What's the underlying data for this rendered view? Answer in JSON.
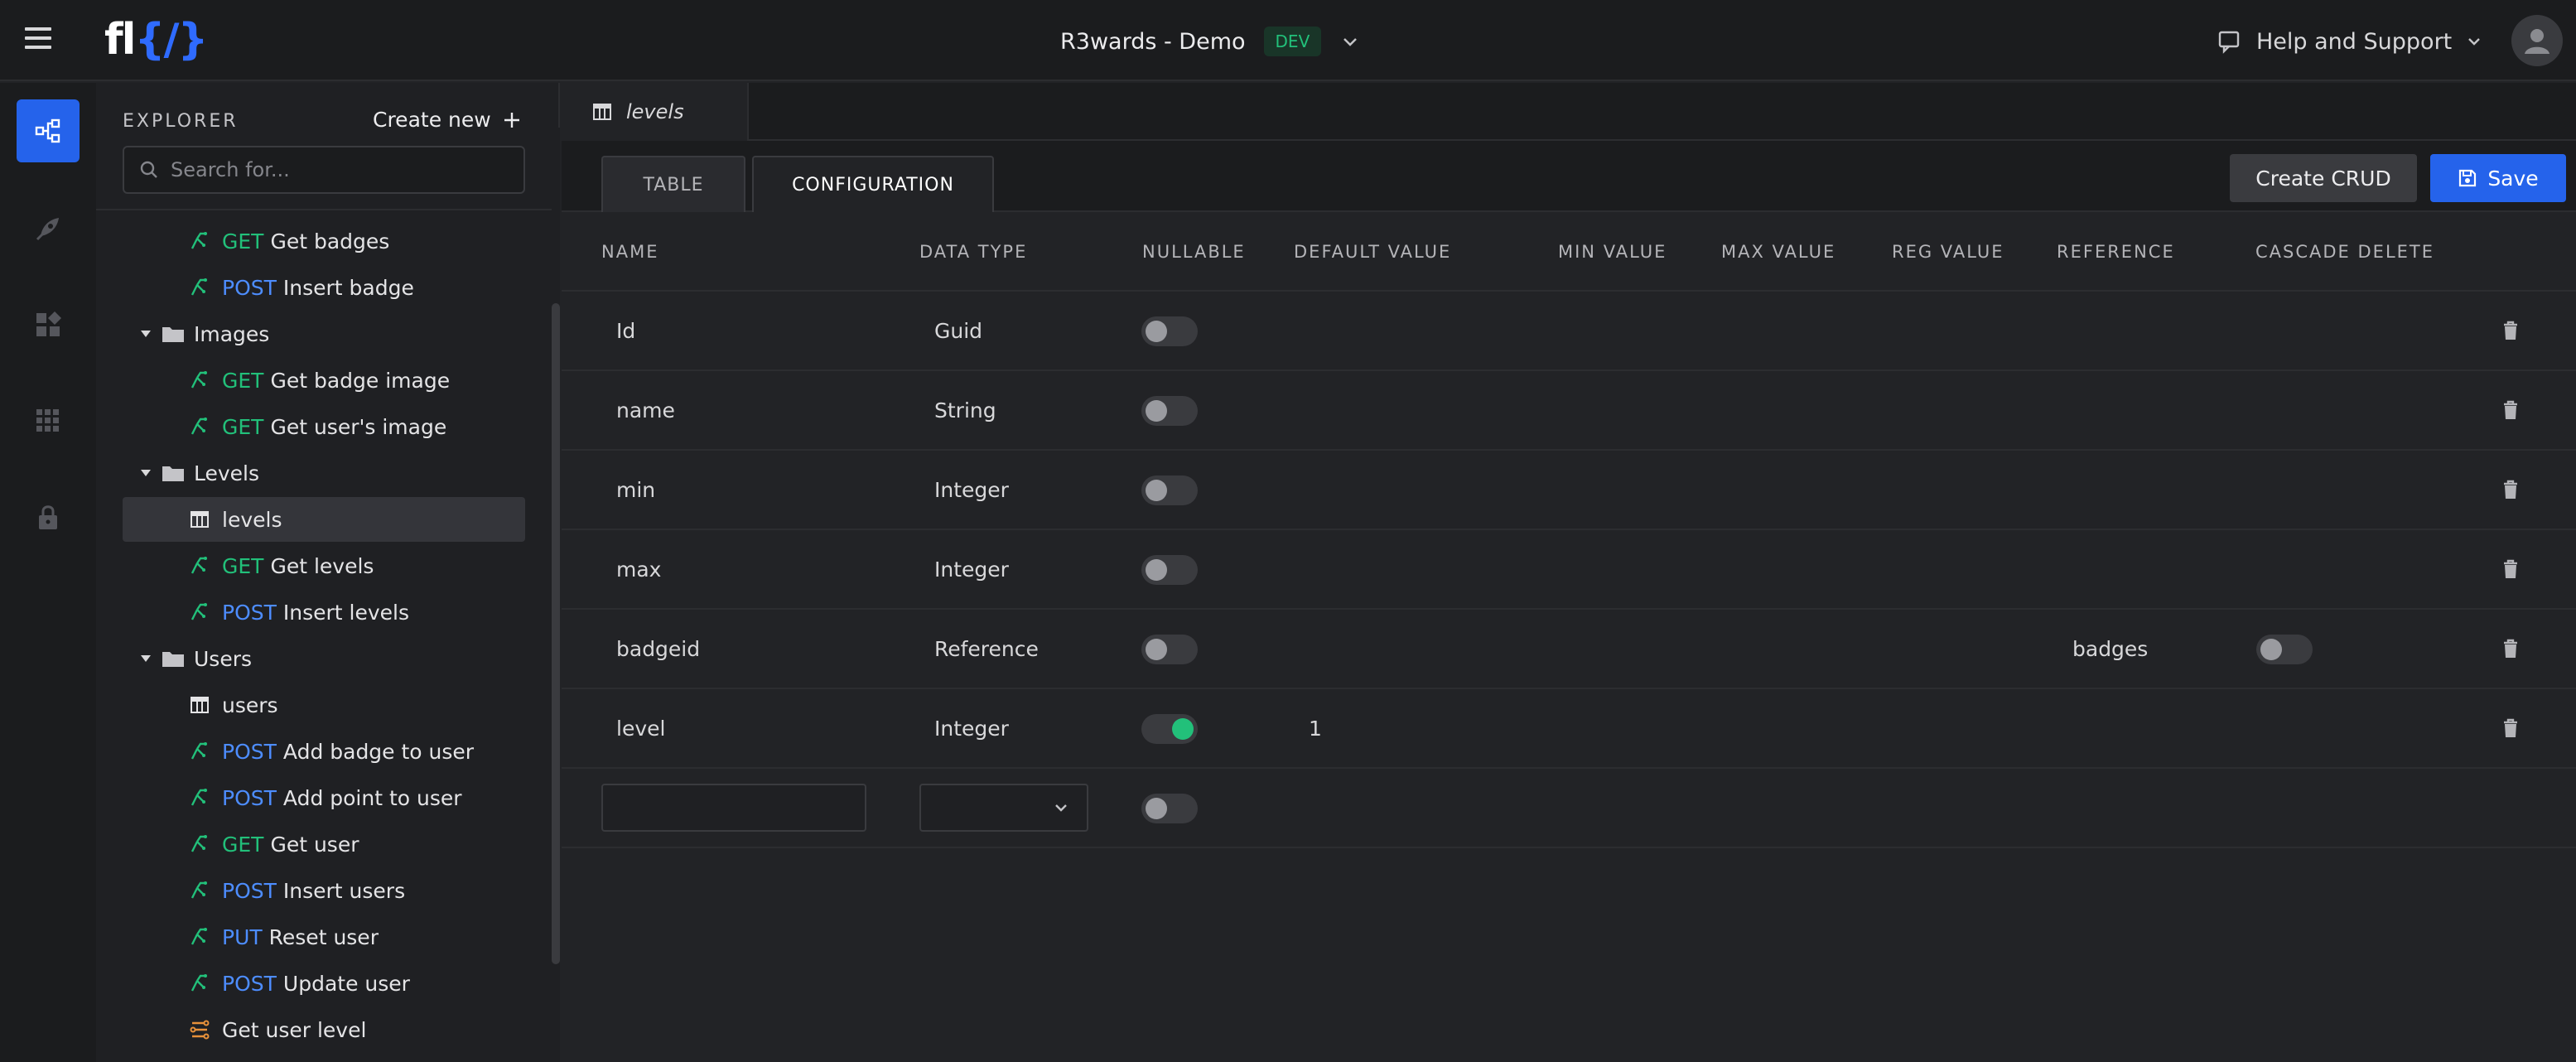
{
  "app": {
    "logo_text": "fl{/}",
    "project_name": "R3wards - Demo",
    "env_badge": "DEV",
    "help_label": "Help and Support"
  },
  "rail": {
    "items": [
      {
        "icon": "flow-icon",
        "active": true
      },
      {
        "icon": "rocket-icon",
        "active": false
      },
      {
        "icon": "widgets-icon",
        "active": false
      },
      {
        "icon": "apps-grid-icon",
        "active": false
      },
      {
        "icon": "lock-icon",
        "active": false
      }
    ]
  },
  "explorer": {
    "title": "EXPLORER",
    "create_new_label": "Create new",
    "search_placeholder": "Search for...",
    "tree": [
      {
        "type": "endpoint",
        "method": "GET",
        "label": "Get badges",
        "level": 2
      },
      {
        "type": "endpoint",
        "method": "POST",
        "label": "Insert badge",
        "level": 2
      },
      {
        "type": "folder",
        "label": "Images",
        "level": 1
      },
      {
        "type": "endpoint",
        "method": "GET",
        "label": "Get badge image",
        "level": 2
      },
      {
        "type": "endpoint",
        "method": "GET",
        "label": "Get user's image",
        "level": 2
      },
      {
        "type": "folder",
        "label": "Levels",
        "level": 1
      },
      {
        "type": "table",
        "label": "levels",
        "level": 2,
        "selected": true
      },
      {
        "type": "endpoint",
        "method": "GET",
        "label": "Get levels",
        "level": 2
      },
      {
        "type": "endpoint",
        "method": "POST",
        "label": "Insert levels",
        "level": 2
      },
      {
        "type": "folder",
        "label": "Users",
        "level": 1
      },
      {
        "type": "table",
        "label": "users",
        "level": 2
      },
      {
        "type": "endpoint",
        "method": "POST",
        "label": "Add badge to user",
        "level": 2
      },
      {
        "type": "endpoint",
        "method": "POST",
        "label": "Add point to user",
        "level": 2
      },
      {
        "type": "endpoint",
        "method": "GET",
        "label": "Get user",
        "level": 2
      },
      {
        "type": "endpoint",
        "method": "POST",
        "label": "Insert users",
        "level": 2
      },
      {
        "type": "endpoint",
        "method": "PUT",
        "label": "Reset user",
        "level": 2
      },
      {
        "type": "endpoint",
        "method": "POST",
        "label": "Update user",
        "level": 2
      },
      {
        "type": "function",
        "label": "Get user level",
        "level": 2
      }
    ]
  },
  "editor": {
    "doc_tab_label": "levels",
    "tabs": [
      {
        "label": "TABLE",
        "active": false
      },
      {
        "label": "CONFIGURATION",
        "active": true
      }
    ],
    "create_crud_label": "Create CRUD",
    "save_label": "Save",
    "columns": {
      "name": "NAME",
      "data_type": "DATA TYPE",
      "nullable": "NULLABLE",
      "default_value": "DEFAULT VALUE",
      "min_value": "MIN VALUE",
      "max_value": "MAX VALUE",
      "reg_value": "REG VALUE",
      "reference": "REFERENCE",
      "cascade_delete": "CASCADE DELETE"
    },
    "rows": [
      {
        "name": "Id",
        "data_type": "Guid",
        "nullable": false,
        "default_value": "",
        "reference": "",
        "cascade_delete": null
      },
      {
        "name": "name",
        "data_type": "String",
        "nullable": false,
        "default_value": "",
        "reference": "",
        "cascade_delete": null
      },
      {
        "name": "min",
        "data_type": "Integer",
        "nullable": false,
        "default_value": "",
        "reference": "",
        "cascade_delete": null
      },
      {
        "name": "max",
        "data_type": "Integer",
        "nullable": false,
        "default_value": "",
        "reference": "",
        "cascade_delete": null
      },
      {
        "name": "badgeid",
        "data_type": "Reference",
        "nullable": false,
        "default_value": "",
        "reference": "badges",
        "cascade_delete": false
      },
      {
        "name": "level",
        "data_type": "Integer",
        "nullable": true,
        "default_value": "1",
        "reference": "",
        "cascade_delete": null
      }
    ],
    "new_row": {
      "name_value": "",
      "data_type_value": "",
      "nullable": false
    }
  },
  "colors": {
    "accent_blue": "#2563eb",
    "get_green": "#22c07a",
    "post_blue": "#4d8dff",
    "function_orange": "#e8913a"
  }
}
